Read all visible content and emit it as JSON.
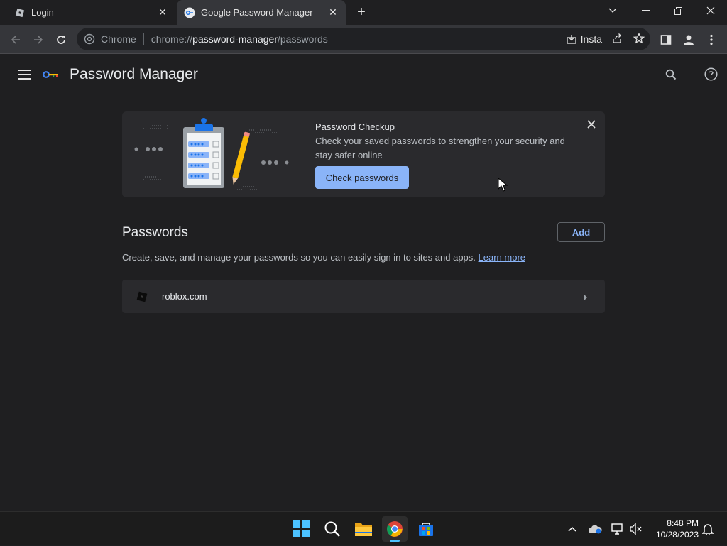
{
  "tabs": [
    {
      "title": "Login",
      "icon": "roblox-favicon"
    },
    {
      "title": "Google Password Manager",
      "icon": "password-manager-favicon",
      "active": true
    }
  ],
  "omnibox": {
    "site_label": "Chrome",
    "url_scheme": "chrome://",
    "url_host": "password-manager",
    "url_path": "/passwords",
    "install_label": "Insta"
  },
  "header": {
    "title": "Password Manager"
  },
  "checkup": {
    "title": "Password Checkup",
    "description": "Check your saved passwords to strengthen your security and stay safer online",
    "button_label": "Check passwords"
  },
  "passwords": {
    "heading": "Passwords",
    "add_label": "Add",
    "description": "Create, save, and manage your passwords so you can easily sign in to sites and apps.",
    "learn_more": "Learn more",
    "items": [
      {
        "site": "roblox.com"
      }
    ]
  },
  "taskbar": {
    "time": "8:48 PM",
    "date": "10/28/2023"
  },
  "colors": {
    "accent": "#8ab4f8",
    "background": "#1f1f21",
    "card": "#2a2a2d"
  }
}
